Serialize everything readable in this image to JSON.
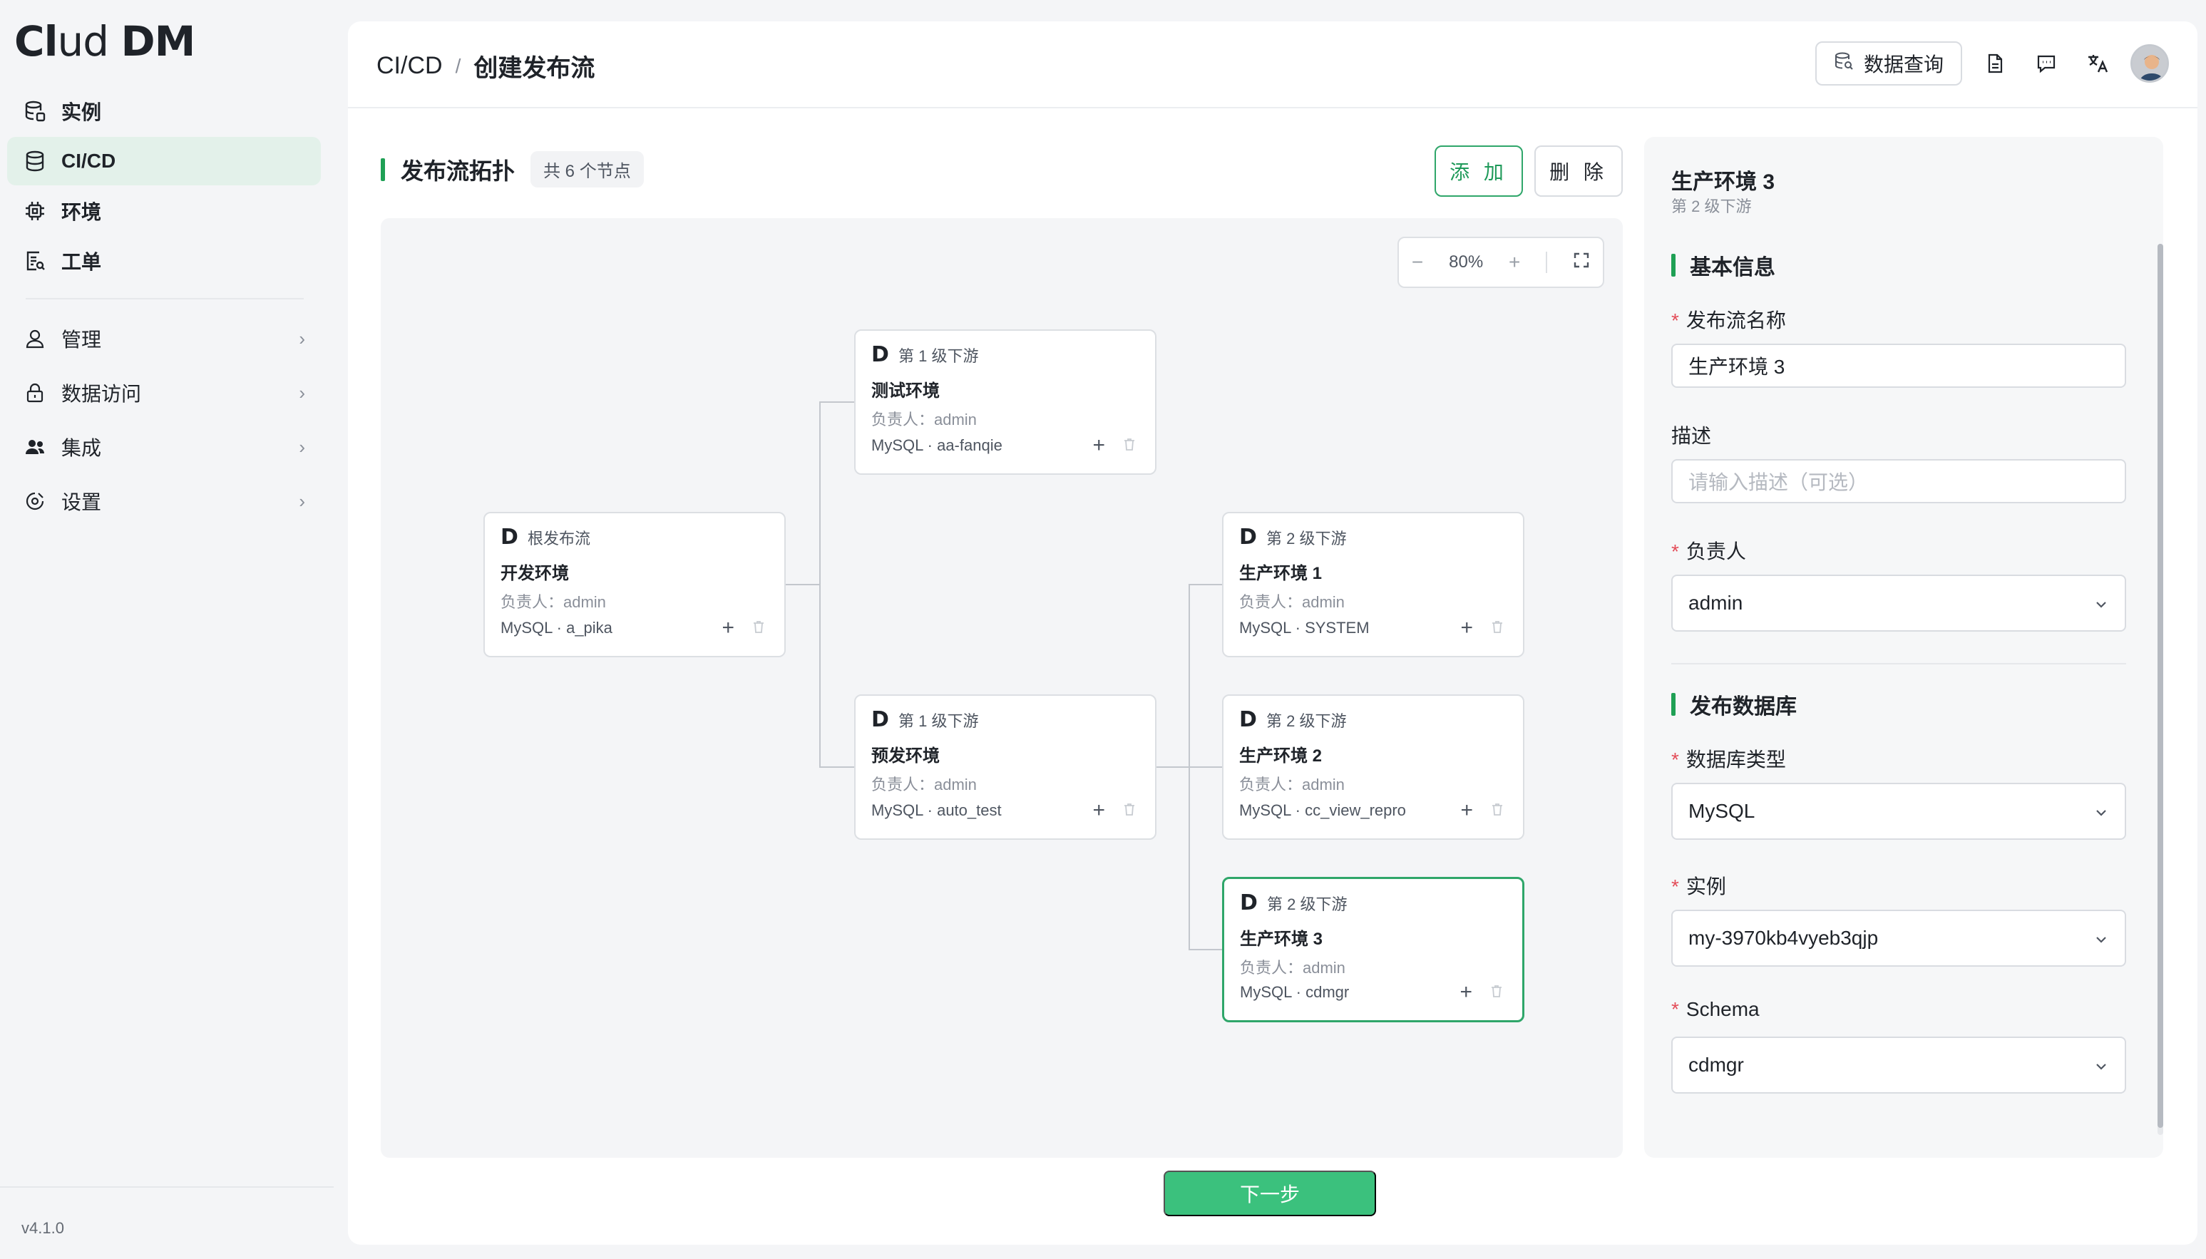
{
  "app": {
    "logo_a": "Cl",
    "logo_b": "ud ",
    "logo_c": "DM",
    "version": "v4.1.0"
  },
  "sidebar": {
    "primary": [
      {
        "label": "实例",
        "icon": "database-stack-icon"
      },
      {
        "label": "CI/CD",
        "icon": "database-icon"
      },
      {
        "label": "环境",
        "icon": "chip-icon"
      },
      {
        "label": "工单",
        "icon": "ticket-icon"
      }
    ],
    "secondary": [
      {
        "label": "管理",
        "icon": "user-icon"
      },
      {
        "label": "数据访问",
        "icon": "lock-icon"
      },
      {
        "label": "集成",
        "icon": "team-icon"
      },
      {
        "label": "设置",
        "icon": "settings-icon"
      }
    ]
  },
  "header": {
    "crumb_root": "CI/CD",
    "crumb_sep": "/",
    "crumb_current": "创建发布流",
    "query_button": "数据查询"
  },
  "topology": {
    "title": "发布流拓扑",
    "count": "共 6 个节点",
    "add_label": "添 加",
    "delete_label": "删 除",
    "zoom_minus": "−",
    "zoom_level": "80%",
    "zoom_plus": "+",
    "nodes": [
      {
        "level": "根发布流",
        "name": "开发环境",
        "owner": "负责人：admin",
        "db": "MySQL · a_pika"
      },
      {
        "level": "第 1 级下游",
        "name": "测试环境",
        "owner": "负责人：admin",
        "db": "MySQL · aa-fanqie"
      },
      {
        "level": "第 1 级下游",
        "name": "预发环境",
        "owner": "负责人：admin",
        "db": "MySQL · auto_test"
      },
      {
        "level": "第 2 级下游",
        "name": "生产环境 1",
        "owner": "负责人：admin",
        "db": "MySQL · SYSTEM"
      },
      {
        "level": "第 2 级下游",
        "name": "生产环境 2",
        "owner": "负责人：admin",
        "db": "MySQL · cc_view_repro"
      },
      {
        "level": "第 2 级下游",
        "name": "生产环境 3",
        "owner": "负责人：admin",
        "db": "MySQL · cdmgr"
      }
    ]
  },
  "form": {
    "title": "生产环境 3",
    "subtitle": "第 2 级下游",
    "section_basic": "基本信息",
    "name_label": "发布流名称",
    "name_value": "生产环境 3",
    "desc_label": "描述",
    "desc_placeholder": "请输入描述（可选）",
    "owner_label": "负责人",
    "owner_value": "admin",
    "section_db": "发布数据库",
    "dbtype_label": "数据库类型",
    "dbtype_value": "MySQL",
    "instance_label": "实例",
    "instance_value": "my-3970kb4vyeb3qjp",
    "schema_label": "Schema",
    "schema_value": "cdmgr",
    "required_mark": "*"
  },
  "footer": {
    "next_label": "下一步"
  },
  "colors": {
    "accent": "#1fa055",
    "primary_button": "#3bc17d",
    "required": "#e34d59"
  }
}
